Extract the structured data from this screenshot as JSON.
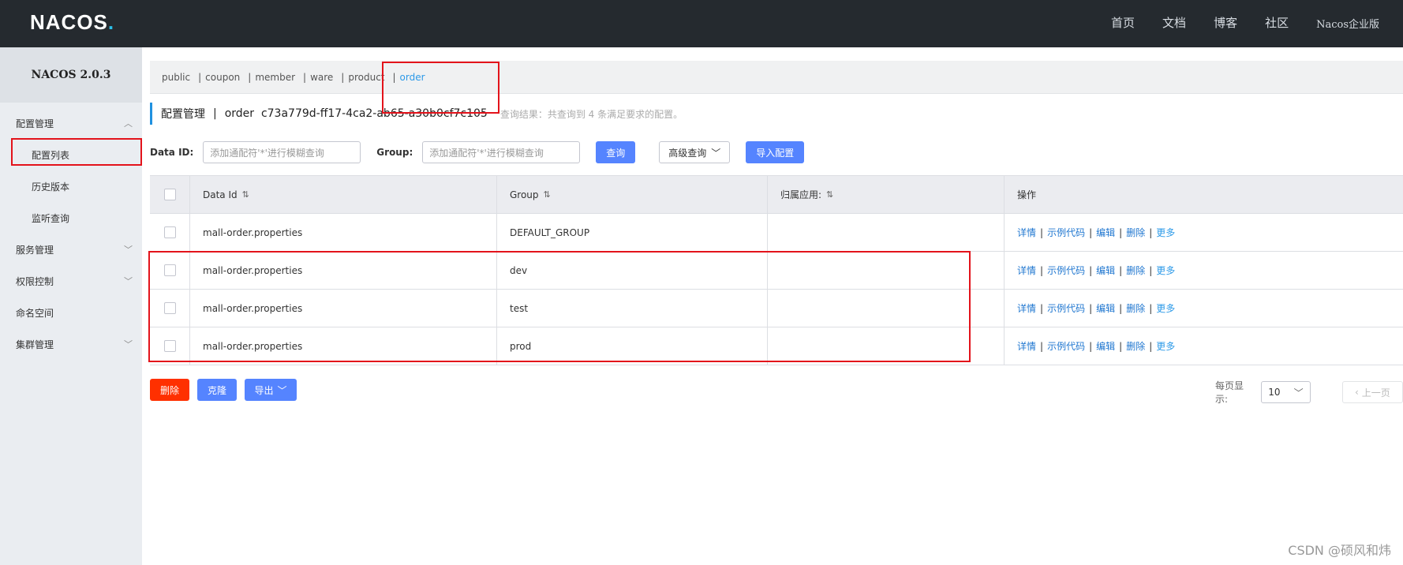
{
  "header": {
    "logo_main": "NACOS",
    "logo_dot": ".",
    "nav": [
      "首页",
      "文档",
      "博客",
      "社区"
    ],
    "enterprise": "Nacos企业版"
  },
  "sidebar": {
    "title": "NACOS 2.0.3",
    "items": [
      {
        "label": "配置管理",
        "chevron": "up"
      },
      {
        "label": "配置列表"
      },
      {
        "label": "历史版本"
      },
      {
        "label": "监听查询"
      },
      {
        "label": "服务管理",
        "chevron": "down"
      },
      {
        "label": "权限控制",
        "chevron": "down"
      },
      {
        "label": "命名空间"
      },
      {
        "label": "集群管理",
        "chevron": "down"
      }
    ]
  },
  "namespaces": [
    "public",
    "coupon",
    "member",
    "ware",
    "product",
    "order"
  ],
  "namespace_active": "order",
  "title": {
    "section": "配置管理",
    "separator": "|",
    "namespace_info": "order  c73a779d-ff17-4ca2-ab65-a30b0cf7c105",
    "result_text": "查询结果：共查询到 4 条满足要求的配置。"
  },
  "search": {
    "dataid_label": "Data ID:",
    "dataid_placeholder": "添加通配符'*'进行模糊查询",
    "group_label": "Group:",
    "group_placeholder": "添加通配符'*'进行模糊查询",
    "query_button": "查询",
    "advanced_button": "高级查询",
    "import_button": "导入配置"
  },
  "table": {
    "headers": [
      "Data Id",
      "Group",
      "归属应用:",
      "操作"
    ],
    "rows": [
      {
        "data_id": "mall-order.properties",
        "group": "DEFAULT_GROUP",
        "app": ""
      },
      {
        "data_id": "mall-order.properties",
        "group": "dev",
        "app": ""
      },
      {
        "data_id": "mall-order.properties",
        "group": "test",
        "app": ""
      },
      {
        "data_id": "mall-order.properties",
        "group": "prod",
        "app": ""
      }
    ],
    "actions": [
      "详情",
      "示例代码",
      "编辑",
      "删除",
      "更多"
    ]
  },
  "bottom": {
    "delete_button": "删除",
    "clone_button": "克隆",
    "export_button": "导出",
    "page_size_label": "每页显示:",
    "page_size_value": "10",
    "prev_page": "上一页"
  },
  "watermark": "CSDN @硕风和炜",
  "colors": {
    "topbar": "#252a2f",
    "primary": "#5584ff",
    "danger": "#ff3000",
    "link": "#2077d0",
    "annotation": "#e3131b"
  }
}
